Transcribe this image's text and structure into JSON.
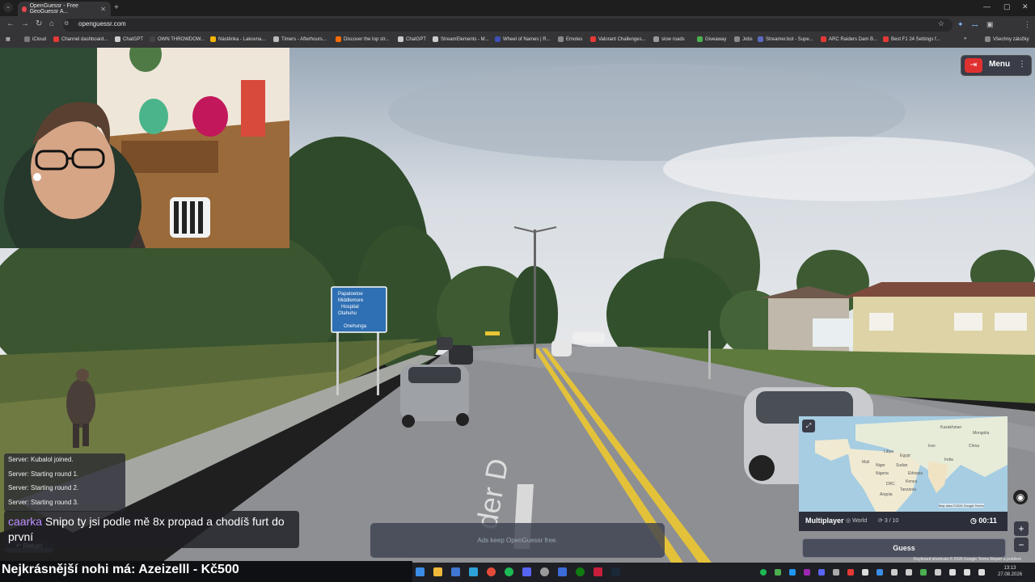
{
  "browser": {
    "tab_title": "OpenGuessr - Free GeoGuessr A...",
    "url": "openguessr.com",
    "tab_close": "✕",
    "new_tab": "+",
    "bookmarks": [
      {
        "label": "iCloud",
        "color": "#7a7a7a"
      },
      {
        "label": "Channel dashboard...",
        "color": "#e53935"
      },
      {
        "label": "ChatGPT",
        "color": "#cccccc"
      },
      {
        "label": "OWN THROWDOW...",
        "color": "#444444"
      },
      {
        "label": "Nástěnka - Lakovna...",
        "color": "#f4b400"
      },
      {
        "label": "Timers - Afterhours...",
        "color": "#bbbbbb"
      },
      {
        "label": "Discover the top str...",
        "color": "#ff6d00"
      },
      {
        "label": "ChatGPT",
        "color": "#cccccc"
      },
      {
        "label": "StreamElements - M...",
        "color": "#cccccc"
      },
      {
        "label": "Wheel of Names | R...",
        "color": "#3f51b5"
      },
      {
        "label": "Emotes",
        "color": "#888888"
      },
      {
        "label": "Valorant Challenges...",
        "color": "#e53935"
      },
      {
        "label": "slow roads",
        "color": "#999999"
      },
      {
        "label": "Giveaway",
        "color": "#4caf50"
      },
      {
        "label": "Jobs",
        "color": "#888888"
      },
      {
        "label": "Streamer.bot - Supe...",
        "color": "#5c6bc0"
      },
      {
        "label": "ARC Raiders Dam B...",
        "color": "#e53935"
      },
      {
        "label": "Best F1 24 Settings f...",
        "color": "#e53935"
      }
    ],
    "bookmarks_all": "Všechny záložky"
  },
  "game": {
    "menu_label": "Menu",
    "exit_icon": "⇥",
    "chat_log": [
      "Server: Kubalol joined.",
      "Server: Starting round 1.",
      "Server: Starting round 2.",
      "Server: Starting round 3."
    ],
    "return_label": "Return",
    "ads_text": "Ads keep OpenGuessr free.",
    "mode": "Multiplayer",
    "map_name": "World",
    "round": "3 / 10",
    "timer": "00:11",
    "guess_label": "Guess",
    "map_credit": "Map data ©2026 Google  Terms",
    "map_labels": [
      "Kazakhstan",
      "Mongolia",
      "Iran",
      "China",
      "Libya",
      "Egypt",
      "India",
      "Mali",
      "Niger",
      "Sudan",
      "Nigeria",
      "Ethiopia",
      "Kenya",
      "DRC",
      "Tanzania",
      "Angola"
    ],
    "attribution": "Keyboard shortcuts   © 2026 Google   Terms   Report a problem",
    "road_sign": {
      "lines": [
        "Papatoetoe",
        "Middlemore",
        "Hospital",
        "Otahuhu",
        "Onehunga"
      ]
    },
    "road_text": "der D",
    "colors": {
      "menu_exit": "#e03131",
      "accent_user": "#b98bff"
    }
  },
  "stream": {
    "chat_user": "caarka",
    "chat_message": " Snipo ty jsi podle mě 8x propad a chodíš furt do první",
    "ticker": "Nejkrásnější nohi má: Azeizelll - Kč500"
  },
  "taskbar": {
    "time": "13:13",
    "date": "27.08.2026"
  }
}
